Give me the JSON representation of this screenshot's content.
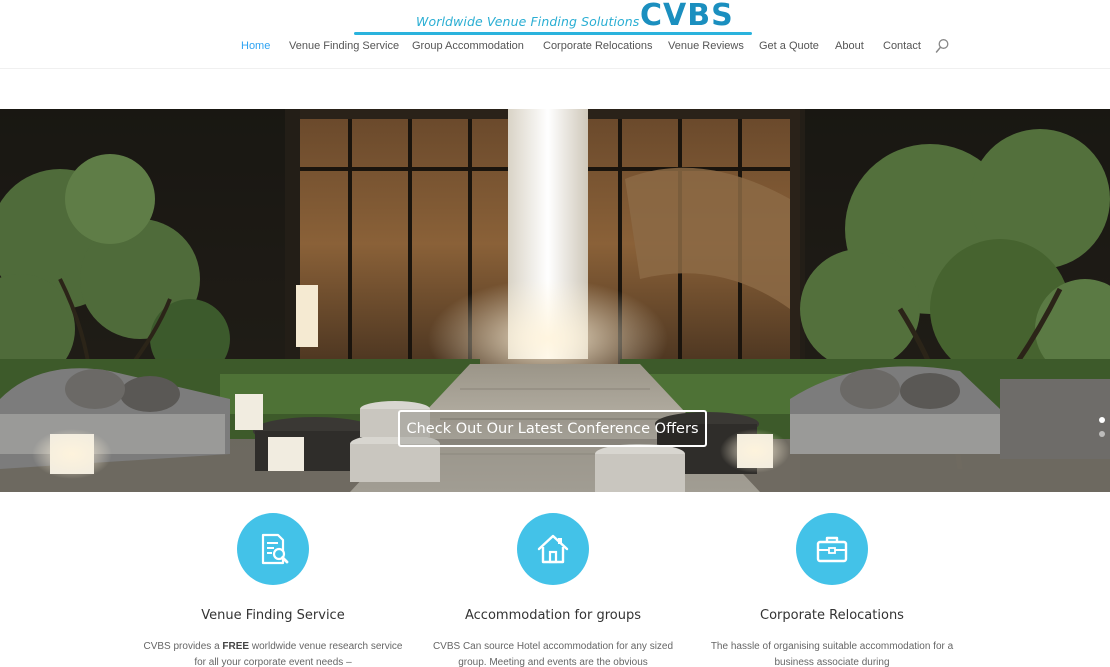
{
  "logo": {
    "tagline": "Worldwide Venue Finding Solutions",
    "mark": "CVBS",
    "accent_color": "#2ab3dd"
  },
  "nav": {
    "items": [
      {
        "label": "Home",
        "active": true
      },
      {
        "label": "Venue Finding Service"
      },
      {
        "label": "Group Accommodation"
      },
      {
        "label": "Corporate Relocations"
      },
      {
        "label": "Venue Reviews"
      },
      {
        "label": "Get a Quote"
      },
      {
        "label": "About"
      },
      {
        "label": "Contact"
      }
    ],
    "search_icon": "search-icon",
    "active_color": "#2ea3f2"
  },
  "hero": {
    "cta_label": "Check Out Our Latest Conference Offers",
    "slides": 2,
    "current_slide": 1
  },
  "features": [
    {
      "icon": "document-search-icon",
      "title": "Venue Finding Service",
      "text_pre": "CVBS provides a ",
      "text_bold": "FREE",
      "text_post": " worldwide venue research service for all your corporate event needs –"
    },
    {
      "icon": "home-icon",
      "title": "Accommodation for groups",
      "text": "CVBS Can source Hotel accommodation for any sized group. Meeting and events are the obvious"
    },
    {
      "icon": "briefcase-icon",
      "title": "Corporate Relocations",
      "text": "The hassle of organising suitable accommodation for a business associate during"
    }
  ],
  "feature_icon_color": "#43c2e8"
}
